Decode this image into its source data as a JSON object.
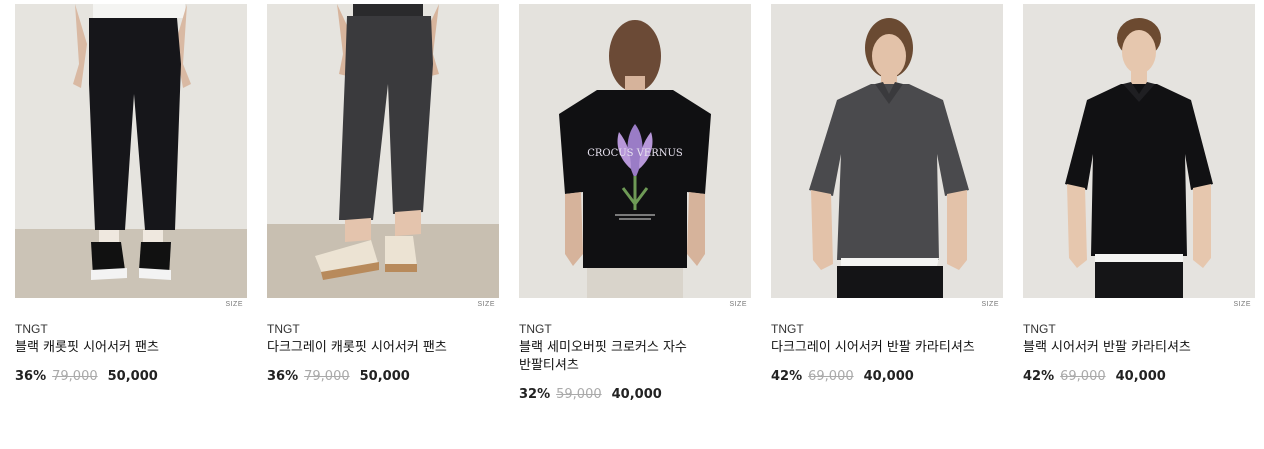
{
  "colors": {
    "background": "#ffffff",
    "image_bg": "#e3e1dc",
    "floor": "#c9c0b2",
    "original_price": "#aaaaaa"
  },
  "products": [
    {
      "image_icon": "black-pants-photo",
      "size_label": "SIZE",
      "brand": "TNGT",
      "name": "블랙 캐롯핏 시어서커 팬츠",
      "discount": "36%",
      "original_price": "79,000",
      "sale_price": "50,000"
    },
    {
      "image_icon": "darkgray-pants-photo",
      "size_label": "SIZE",
      "brand": "TNGT",
      "name": "다크그레이 캐롯핏 시어서커 팬츠",
      "discount": "36%",
      "original_price": "79,000",
      "sale_price": "50,000"
    },
    {
      "image_icon": "black-tshirt-back-photo",
      "size_label": "SIZE",
      "brand": "TNGT",
      "name": "블랙 세미오버핏 크로커스 자수 반팔티셔츠",
      "discount": "32%",
      "original_price": "59,000",
      "sale_price": "40,000",
      "print_text": "CROCUS VERNUS"
    },
    {
      "image_icon": "darkgray-shirt-photo",
      "size_label": "SIZE",
      "brand": "TNGT",
      "name": "다크그레이 시어서커 반팔 카라티셔츠",
      "discount": "42%",
      "original_price": "69,000",
      "sale_price": "40,000"
    },
    {
      "image_icon": "black-shirt-photo",
      "size_label": "SIZE",
      "brand": "TNGT",
      "name": "블랙 시어서커 반팔 카라티셔츠",
      "discount": "42%",
      "original_price": "69,000",
      "sale_price": "40,000"
    }
  ]
}
